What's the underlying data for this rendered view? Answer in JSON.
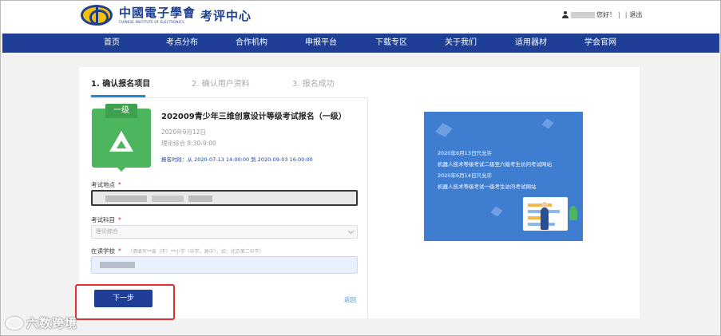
{
  "header": {
    "logo_cn": "中國電子學會",
    "logo_en": "CHINESE INSTITUTE OF ELECTRONICS",
    "logo_sub": "考评中心",
    "greeting": "您好！",
    "separator": "|",
    "logout": "退出"
  },
  "nav": [
    "首页",
    "考点分布",
    "合作机构",
    "申报平台",
    "下载专区",
    "关于我们",
    "适用器材",
    "学会官网"
  ],
  "steps": [
    "1. 确认报名项目",
    "2. 确认用户资料",
    "3. 报名成功"
  ],
  "exam": {
    "badge_label": "一级",
    "title": "202009青少年三维创意设计等级考试报名（一级）",
    "date": "2020年9月12日",
    "time": "理论综合 8:30-9:00",
    "period": "报名时段：从 2020-07-13 14:00:00 到 2020-09-03 16:00:00"
  },
  "form": {
    "location_label": "考试地点",
    "subject_label": "考试科目",
    "subject_value": "理论综合",
    "school_label": "在读学校",
    "school_hint": "（请填写**省（市）**小学（中学、高中），如：北京第二中学）",
    "required_mark": "*"
  },
  "actions": {
    "next": "下一步",
    "back": "返回"
  },
  "notice": {
    "lines": [
      "2020年6月13日只允许",
      "机器人技术等级考试二级至六级考生访问考试网站",
      "2020年6月14日只允许",
      "机器人技术等级考试一级考生访问考试网站"
    ]
  },
  "watermark": "六数跨境",
  "colors": {
    "nav_bg": "#1e3f95",
    "accent": "#1e8bd6",
    "badge_green": "#4db55d",
    "notice_bg": "#3f7dd1",
    "required": "#e02424",
    "highlight": "#e03030"
  }
}
